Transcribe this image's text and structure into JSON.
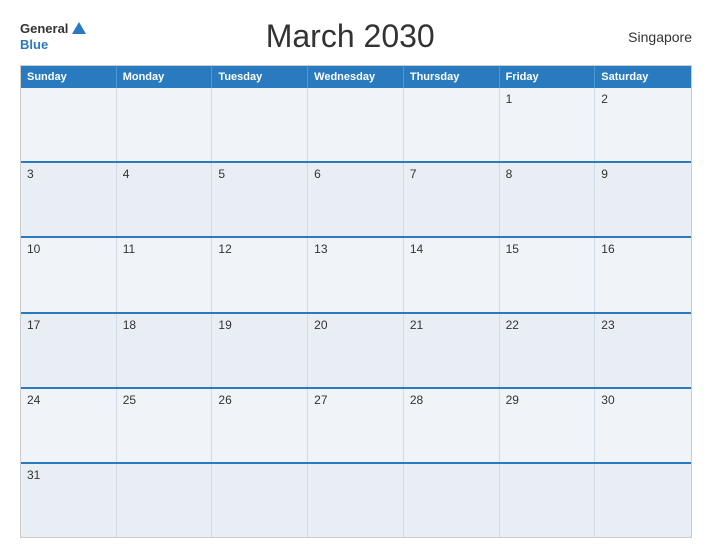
{
  "header": {
    "logo_general": "General",
    "logo_blue": "Blue",
    "title": "March 2030",
    "location": "Singapore"
  },
  "calendar": {
    "days": [
      "Sunday",
      "Monday",
      "Tuesday",
      "Wednesday",
      "Thursday",
      "Friday",
      "Saturday"
    ],
    "weeks": [
      [
        {
          "day": "",
          "empty": true
        },
        {
          "day": "",
          "empty": true
        },
        {
          "day": "",
          "empty": true
        },
        {
          "day": "",
          "empty": true
        },
        {
          "day": "",
          "empty": true
        },
        {
          "day": "1",
          "empty": false
        },
        {
          "day": "2",
          "empty": false
        }
      ],
      [
        {
          "day": "3",
          "empty": false
        },
        {
          "day": "4",
          "empty": false
        },
        {
          "day": "5",
          "empty": false
        },
        {
          "day": "6",
          "empty": false
        },
        {
          "day": "7",
          "empty": false
        },
        {
          "day": "8",
          "empty": false
        },
        {
          "day": "9",
          "empty": false
        }
      ],
      [
        {
          "day": "10",
          "empty": false
        },
        {
          "day": "11",
          "empty": false
        },
        {
          "day": "12",
          "empty": false
        },
        {
          "day": "13",
          "empty": false
        },
        {
          "day": "14",
          "empty": false
        },
        {
          "day": "15",
          "empty": false
        },
        {
          "day": "16",
          "empty": false
        }
      ],
      [
        {
          "day": "17",
          "empty": false
        },
        {
          "day": "18",
          "empty": false
        },
        {
          "day": "19",
          "empty": false
        },
        {
          "day": "20",
          "empty": false
        },
        {
          "day": "21",
          "empty": false
        },
        {
          "day": "22",
          "empty": false
        },
        {
          "day": "23",
          "empty": false
        }
      ],
      [
        {
          "day": "24",
          "empty": false
        },
        {
          "day": "25",
          "empty": false
        },
        {
          "day": "26",
          "empty": false
        },
        {
          "day": "27",
          "empty": false
        },
        {
          "day": "28",
          "empty": false
        },
        {
          "day": "29",
          "empty": false
        },
        {
          "day": "30",
          "empty": false
        }
      ],
      [
        {
          "day": "31",
          "empty": false
        },
        {
          "day": "",
          "empty": true
        },
        {
          "day": "",
          "empty": true
        },
        {
          "day": "",
          "empty": true
        },
        {
          "day": "",
          "empty": true
        },
        {
          "day": "",
          "empty": true
        },
        {
          "day": "",
          "empty": true
        }
      ]
    ]
  }
}
